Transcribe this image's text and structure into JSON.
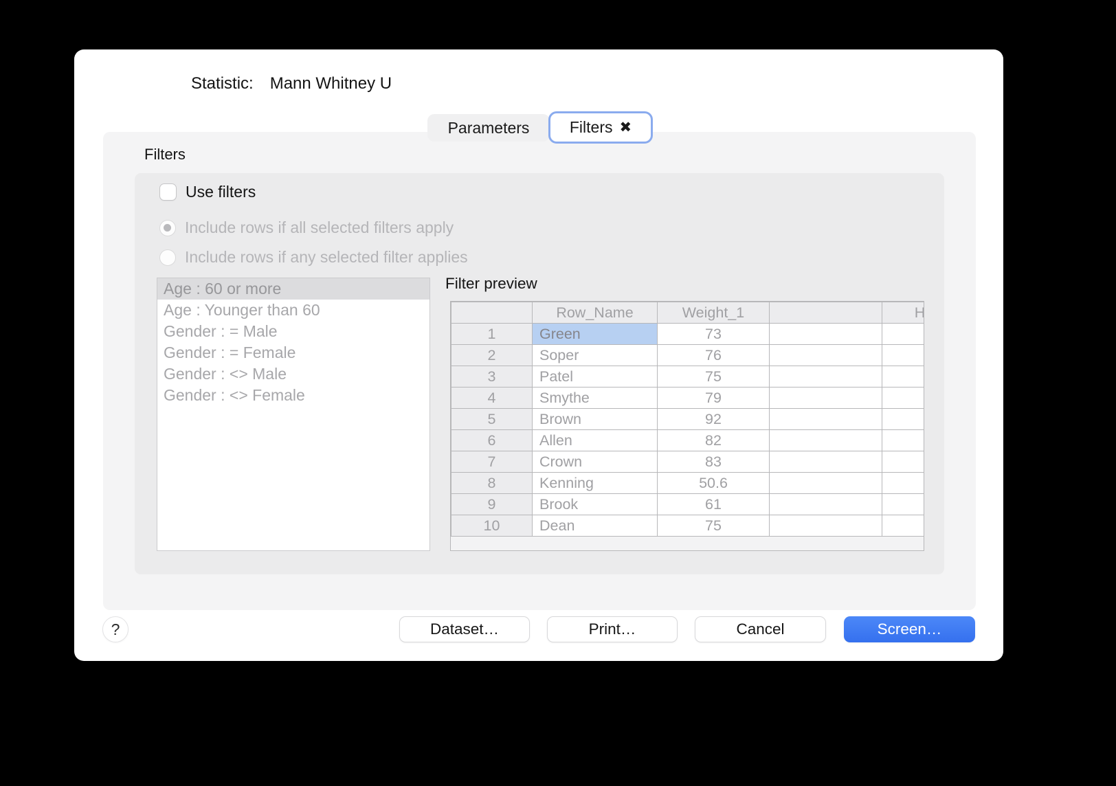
{
  "window": {
    "statistic_label": "Statistic:",
    "statistic_value": "Mann Whitney U"
  },
  "tabs": [
    {
      "label": "Parameters",
      "active": false
    },
    {
      "label": "Filters",
      "active": true,
      "close_icon": "✖"
    }
  ],
  "filters_section": {
    "title": "Filters",
    "use_filters": {
      "label": "Use filters",
      "checked": false
    },
    "radio_options": [
      {
        "label": "Include rows if all selected filters apply",
        "selected": true,
        "enabled": false
      },
      {
        "label": "Include rows if any selected filter applies",
        "selected": false,
        "enabled": false
      }
    ],
    "filter_list": {
      "items": [
        "Age : 60 or more",
        "Age : Younger than 60",
        "Gender : = Male",
        "Gender : = Female",
        "Gender : <> Male",
        "Gender : <> Female"
      ],
      "selected_index": 0
    },
    "preview": {
      "label": "Filter preview",
      "columns": [
        "",
        "Row_Name",
        "Weight_1",
        "",
        "H"
      ],
      "rows": [
        {
          "num": "1",
          "name": "Green",
          "weight": "73"
        },
        {
          "num": "2",
          "name": "Soper",
          "weight": "76"
        },
        {
          "num": "3",
          "name": "Patel",
          "weight": "75"
        },
        {
          "num": "4",
          "name": "Smythe",
          "weight": "79"
        },
        {
          "num": "5",
          "name": "Brown",
          "weight": "92"
        },
        {
          "num": "6",
          "name": "Allen",
          "weight": "82"
        },
        {
          "num": "7",
          "name": "Crown",
          "weight": "83"
        },
        {
          "num": "8",
          "name": "Kenning",
          "weight": "50.6"
        },
        {
          "num": "9",
          "name": "Brook",
          "weight": "61"
        },
        {
          "num": "10",
          "name": "Dean",
          "weight": "75"
        }
      ],
      "selected_cell": {
        "row_index": 0,
        "column": "name"
      }
    }
  },
  "footer": {
    "help_label": "?",
    "buttons": [
      {
        "label": "Dataset…",
        "primary": false
      },
      {
        "label": "Print…",
        "primary": false
      },
      {
        "label": "Cancel",
        "primary": false
      },
      {
        "label": "Screen…",
        "primary": true
      }
    ]
  },
  "colors": {
    "accent_blue": "#3b78f2",
    "tab_active_border": "#8aabee",
    "selected_cell_bg": "#b7d0f2",
    "selected_list_item_bg": "#dcdcde"
  }
}
